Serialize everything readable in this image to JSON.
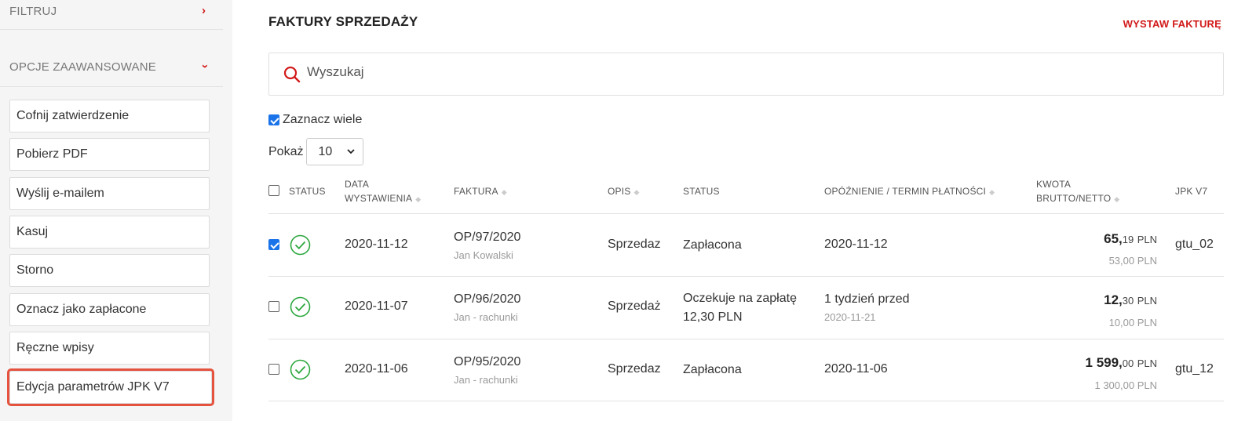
{
  "sidebar": {
    "filter_label": "FILTRUJ",
    "advanced_label": "OPCJE ZAAWANSOWANE",
    "actions": [
      "Cofnij zatwierdzenie",
      "Pobierz PDF",
      "Wyślij e-mailem",
      "Kasuj",
      "Storno",
      "Oznacz jako zapłacone",
      "Ręczne wpisy",
      "Edycja parametrów JPK V7"
    ]
  },
  "header": {
    "title": "FAKTURY SPRZEDAŻY",
    "issue_button": "WYSTAW FAKTURĘ"
  },
  "search": {
    "placeholder": "Wyszukaj",
    "value": ""
  },
  "select_many": {
    "label": "Zaznacz wiele",
    "checked": true
  },
  "page_size": {
    "label": "Pokaż",
    "value": "10"
  },
  "columns": {
    "status_cb": "STATUS",
    "date_line1": "DATA",
    "date_line2": "WYSTAWIENIA",
    "invoice": "FAKTURA",
    "desc": "OPIS",
    "status": "STATUS",
    "delay": "OPÓŹNIENIE / TERMIN PŁATNOŚCI",
    "amount_line1": "KWOTA",
    "amount_line2": "BRUTTO/NETTO",
    "jpk": "JPK V7"
  },
  "rows": [
    {
      "checked": true,
      "date": "2020-11-12",
      "invoice": "OP/97/2020",
      "client": "Jan Kowalski",
      "desc": "Sprzedaz",
      "status1": "Zapłacona",
      "status2": "",
      "delay": "2020-11-12",
      "delay_sub": "",
      "gross_int": "65,",
      "gross_dec": "19",
      "currency": "PLN",
      "net": "53,00 PLN",
      "jpk": "gtu_02"
    },
    {
      "checked": false,
      "date": "2020-11-07",
      "invoice": "OP/96/2020",
      "client": "Jan - rachunki",
      "desc": "Sprzedaż",
      "status1": "Oczekuje na zapłatę",
      "status2": "12,30 PLN",
      "delay": "1 tydzień przed",
      "delay_sub": "2020-11-21",
      "gross_int": "12,",
      "gross_dec": "30",
      "currency": "PLN",
      "net": "10,00 PLN",
      "jpk": ""
    },
    {
      "checked": false,
      "date": "2020-11-06",
      "invoice": "OP/95/2020",
      "client": "Jan - rachunki",
      "desc": "Sprzedaz",
      "status1": "Zapłacona",
      "status2": "",
      "delay": "2020-11-06",
      "delay_sub": "",
      "gross_int": "1 599,",
      "gross_dec": "00",
      "currency": "PLN",
      "net": "1 300,00 PLN",
      "jpk": "gtu_12"
    }
  ],
  "colors": {
    "accent": "#d21a1a",
    "status_ok": "#2ea83f",
    "checkbox": "#1a73e8",
    "highlight": "#e5533f"
  }
}
